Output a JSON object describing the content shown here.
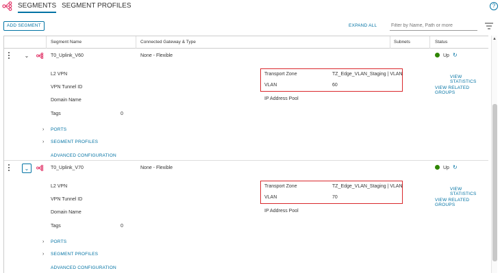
{
  "tabs": {
    "segments": "SEGMENTS",
    "segment_profiles": "SEGMENT PROFILES"
  },
  "help_label": "?",
  "toolbar": {
    "add_segment": "ADD SEGMENT",
    "expand_all": "EXPAND ALL",
    "filter_placeholder": "Filter by Name, Path or more"
  },
  "columns": {
    "segment_name": "Segment Name",
    "connected_gateway": "Connected Gateway & Type",
    "subnets": "Subnets",
    "status": "Status"
  },
  "segments": [
    {
      "name": "T0_Uplink_V60",
      "gateway": "None - Flexible",
      "status": "Up",
      "l2vpn_label": "L2 VPN",
      "vpn_tunnel_label": "VPN Tunnel ID",
      "domain_label": "Domain Name",
      "tags_label": "Tags",
      "tags_count": "0",
      "transport_zone_label": "Transport Zone",
      "transport_zone_value": "TZ_Edge_VLAN_Staging | VLAN",
      "vlan_label": "VLAN",
      "vlan_value": "60",
      "ip_pool_label": "IP Address Pool",
      "view_statistics": "VIEW STATISTICS",
      "view_related_groups": "VIEW RELATED GROUPS",
      "ports": "PORTS",
      "segment_profiles": "SEGMENT PROFILES",
      "advanced_config": "ADVANCED CONFIGURATION"
    },
    {
      "name": "T0_Uplink_V70",
      "gateway": "None - Flexible",
      "status": "Up",
      "l2vpn_label": "L2 VPN",
      "vpn_tunnel_label": "VPN Tunnel ID",
      "domain_label": "Domain Name",
      "tags_label": "Tags",
      "tags_count": "0",
      "transport_zone_label": "Transport Zone",
      "transport_zone_value": "TZ_Edge_VLAN_Staging | VLAN",
      "vlan_label": "VLAN",
      "vlan_value": "70",
      "ip_pool_label": "IP Address Pool",
      "view_statistics": "VIEW STATISTICS",
      "view_related_groups": "VIEW RELATED GROUPS",
      "ports": "PORTS",
      "segment_profiles": "SEGMENT PROFILES",
      "advanced_config": "ADVANCED CONFIGURATION"
    }
  ],
  "colors": {
    "accent": "#0072a3",
    "status_up": "#2e8500",
    "highlight": "#d9262a",
    "segment_icon": "#e2386b"
  },
  "icons": [
    "segments-logo-icon",
    "help-icon",
    "filter-icon",
    "kebab-menu-icon",
    "chevron-down-icon",
    "segment-icon",
    "status-dot-icon",
    "refresh-icon",
    "chevron-right-icon"
  ]
}
